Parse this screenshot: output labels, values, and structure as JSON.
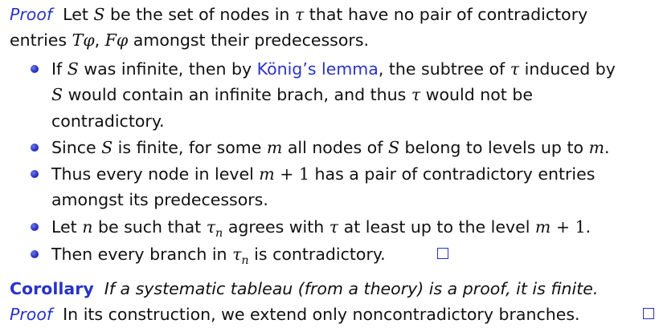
{
  "proof1": {
    "label": "Proof",
    "text": "Let S be the set of nodes in τ that have no pair of contradictory entries Tφ, Fφ amongst their predecessors."
  },
  "bullets": [
    {
      "prefix": "If S was infinite, then by ",
      "link": "König’s lemma",
      "suffix": ", the subtree of τ induced by S would contain an infinite brach, and thus τ would not be contradictory."
    },
    {
      "text": "Since S is finite, for some m all nodes of S belong to levels up to m."
    },
    {
      "text": "Thus every node in level m + 1 has a pair of contradictory entries amongst its predecessors."
    },
    {
      "text": "Let n be such that τn agrees with τ at least up to the level m + 1."
    },
    {
      "text": "Then every branch in τn is contradictory."
    }
  ],
  "corollary": {
    "label": "Corollary",
    "text": "If a systematic tableau (from a theory) is a proof, it is finite."
  },
  "proof2": {
    "label": "Proof",
    "text": "In its construction, we extend only noncontradictory branches."
  },
  "colors": {
    "accent": "#2a33c6",
    "text": "#111111",
    "background": "#ffffff"
  }
}
